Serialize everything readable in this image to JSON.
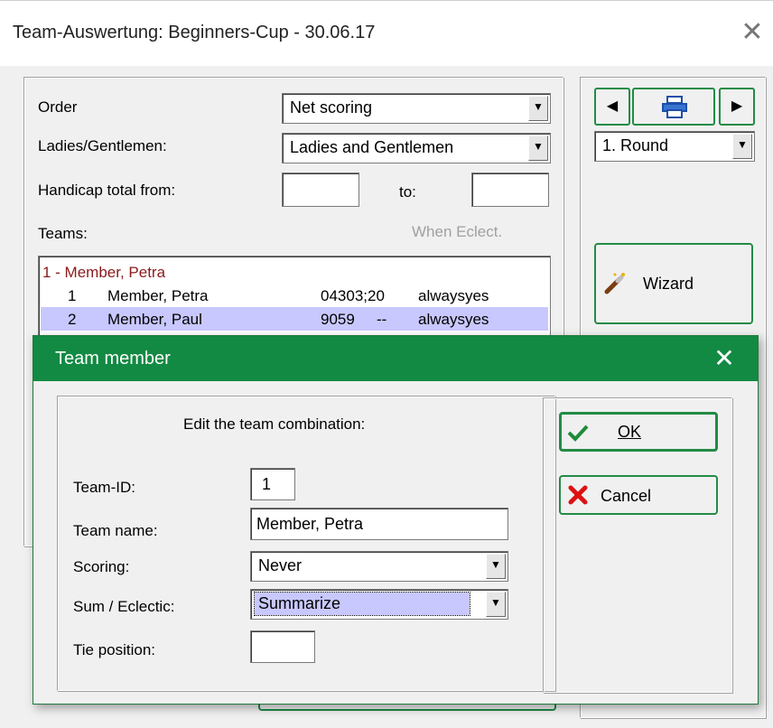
{
  "window": {
    "title": "Team-Auswertung: Beginners-Cup - 30.06.17",
    "close_glyph": "✕"
  },
  "filters": {
    "order_label": "Order",
    "order_value": "Net scoring",
    "gender_label": "Ladies/Gentlemen:",
    "gender_value": "Ladies and Gentlemen",
    "handicap_label": "Handicap total from:",
    "handicap_from": "",
    "handicap_to_label": "to:",
    "handicap_to": "",
    "teams_label": "Teams:",
    "when_eclect_label": "When Eclect."
  },
  "teams_list": {
    "group_header": "1 - Member, Petra",
    "rows": [
      {
        "num": "1",
        "name": "Member, Petra",
        "id": "04303;20",
        "mode": "alwaysyes"
      },
      {
        "num": "2",
        "name": "Member, Paul",
        "id": "9059",
        "sep": "--",
        "mode": "alwaysyes"
      }
    ]
  },
  "right_panel": {
    "round_value": "1. Round",
    "wizard_label": "Wizard"
  },
  "dialog": {
    "title": "Team member",
    "close_glyph": "✕",
    "heading": "Edit the team combination:",
    "team_id_label": "Team-ID:",
    "team_id_value": "1",
    "team_name_label": "Team name:",
    "team_name_value": "Member, Petra",
    "scoring_label": "Scoring:",
    "scoring_value": "Never",
    "sum_label": "Sum / Eclectic:",
    "sum_value": "Summarize",
    "tie_label": "Tie position:",
    "tie_value": "",
    "ok_label": "OK",
    "cancel_label": "Cancel"
  },
  "colors": {
    "accent_green": "#128a43",
    "button_border_green": "#228b45",
    "selection_row": "#c8c8ff",
    "group_header_text": "#8b1a1a"
  },
  "icons": {
    "nav_prev": "triangle-left-icon",
    "nav_print": "printer-icon",
    "nav_next": "triangle-right-icon",
    "wizard": "magic-wand-icon",
    "ok": "checkmark-icon",
    "cancel": "red-x-icon"
  }
}
